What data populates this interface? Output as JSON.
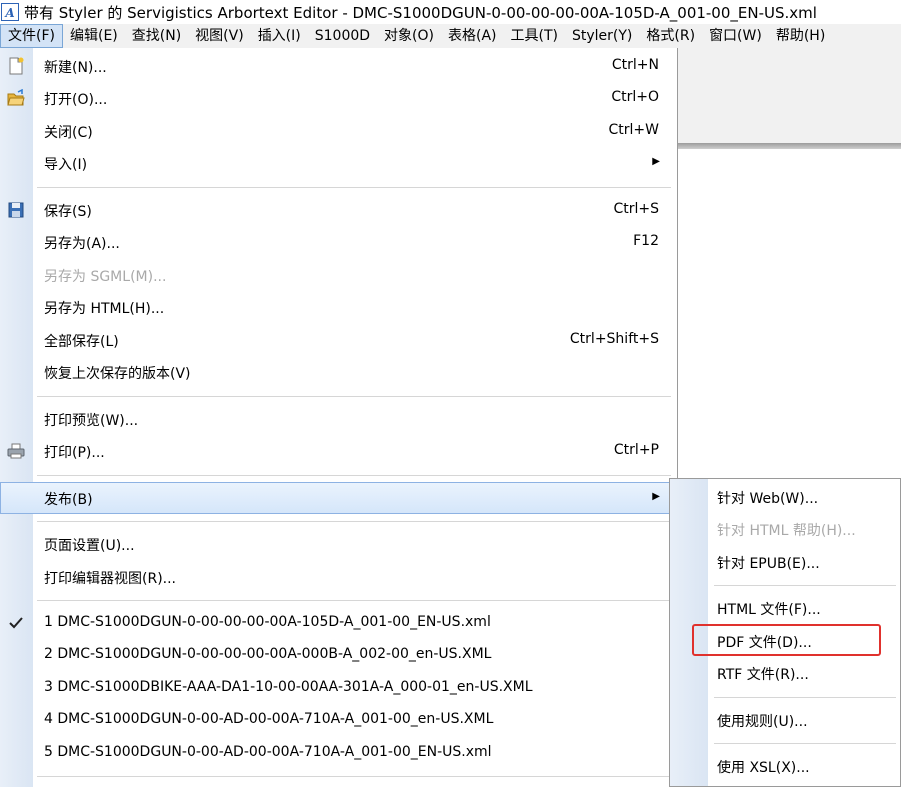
{
  "window": {
    "title": "带有 Styler 的 Servigistics Arbortext Editor - DMC-S1000DGUN-0-00-00-00-00A-105D-A_001-00_EN-US.xml"
  },
  "menubar": {
    "items": [
      "文件(F)",
      "编辑(E)",
      "查找(N)",
      "视图(V)",
      "插入(I)",
      "S1000D",
      "对象(O)",
      "表格(A)",
      "工具(T)",
      "Styler(Y)",
      "格式(R)",
      "窗口(W)",
      "帮助(H)"
    ]
  },
  "file_menu": {
    "new": {
      "label": "新建(N)...",
      "accel": "Ctrl+N"
    },
    "open": {
      "label": "打开(O)...",
      "accel": "Ctrl+O"
    },
    "close": {
      "label": "关闭(C)",
      "accel": "Ctrl+W"
    },
    "import": {
      "label": "导入(I)"
    },
    "save": {
      "label": "保存(S)",
      "accel": "Ctrl+S"
    },
    "save_as": {
      "label": "另存为(A)...",
      "accel": "F12"
    },
    "save_as_sgml": {
      "label": "另存为 SGML(M)..."
    },
    "save_as_html": {
      "label": "另存为 HTML(H)..."
    },
    "save_all": {
      "label": "全部保存(L)",
      "accel": "Ctrl+Shift+S"
    },
    "revert": {
      "label": "恢复上次保存的版本(V)"
    },
    "print_preview": {
      "label": "打印预览(W)..."
    },
    "print": {
      "label": "打印(P)...",
      "accel": "Ctrl+P"
    },
    "publish": {
      "label": "发布(B)"
    },
    "page_setup": {
      "label": "页面设置(U)..."
    },
    "print_editor_view": {
      "label": "打印编辑器视图(R)..."
    },
    "recent": [
      "1 DMC-S1000DGUN-0-00-00-00-00A-105D-A_001-00_EN-US.xml",
      "2 DMC-S1000DGUN-0-00-00-00-00A-000B-A_002-00_en-US.XML",
      "3 DMC-S1000DBIKE-AAA-DA1-10-00-00AA-301A-A_000-01_en-US.XML",
      "4 DMC-S1000DGUN-0-00-AD-00-00A-710A-A_001-00_en-US.XML",
      "5 DMC-S1000DGUN-0-00-AD-00-00A-710A-A_001-00_EN-US.xml"
    ]
  },
  "publish_submenu": {
    "items": [
      {
        "label": "针对 Web(W)...",
        "disabled": false
      },
      {
        "label": "针对 HTML 帮助(H)...",
        "disabled": true
      },
      {
        "label": "针对 EPUB(E)...",
        "disabled": false
      },
      {
        "label": "HTML 文件(F)...",
        "disabled": false
      },
      {
        "label": "PDF 文件(D)...",
        "disabled": false
      },
      {
        "label": "RTF 文件(R)...",
        "disabled": false
      },
      {
        "label": "使用规则(U)...",
        "disabled": false
      },
      {
        "label": "使用 XSL(X)...",
        "disabled": false
      }
    ]
  },
  "colors": {
    "highlight_box": "#e0312d",
    "menu_hover": "#d5e6fa"
  }
}
